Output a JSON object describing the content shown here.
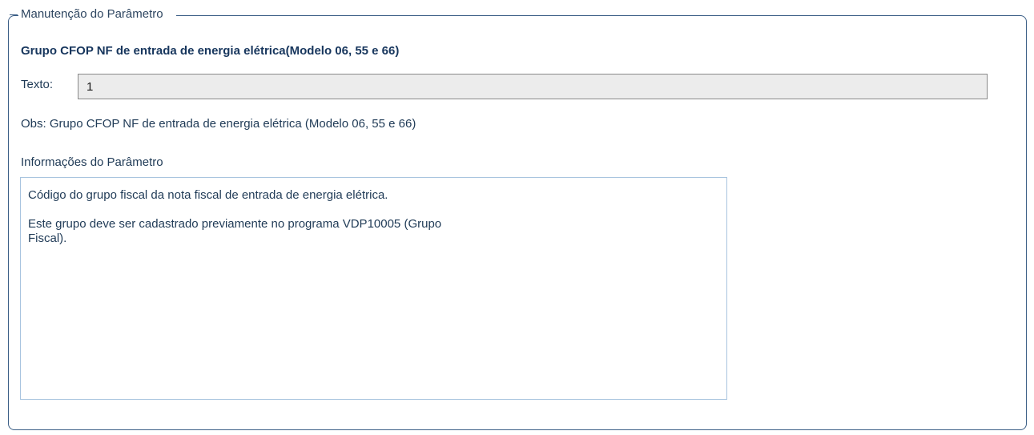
{
  "fieldset": {
    "legend": "Manutenção do Parâmetro"
  },
  "parameter": {
    "title": "Grupo CFOP NF de entrada de energia elétrica(Modelo 06, 55 e 66)",
    "texto_label": "Texto:",
    "texto_value": "1",
    "obs": "Obs: Grupo CFOP NF de entrada de energia elétrica (Modelo 06, 55 e 66)"
  },
  "info": {
    "label": "Informações do Parâmetro",
    "paragraphs": [
      "Código do grupo fiscal da nota fiscal de entrada de energia elétrica.",
      "Este grupo deve ser cadastrado previamente no programa VDP10005 (Grupo\nFiscal)."
    ]
  }
}
